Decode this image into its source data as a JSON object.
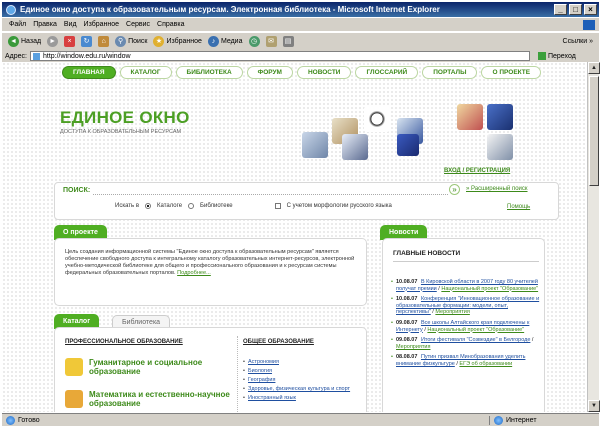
{
  "window": {
    "title": "Единое окно доступа к образовательным ресурсам. Электронная библиотека - Microsoft Internet Explorer",
    "buttons": [
      "_",
      "□",
      "×"
    ]
  },
  "menu": [
    "Файл",
    "Правка",
    "Вид",
    "Избранное",
    "Сервис",
    "Справка"
  ],
  "toolbar": {
    "back": "Назад",
    "search": "Поиск",
    "favorites": "Избранное",
    "media": "Медиа",
    "links": "Ссылки »"
  },
  "address": {
    "label": "Адрес:",
    "url": "http://window.edu.ru/window",
    "go": "Переход"
  },
  "status": {
    "left": "Готово",
    "right": "Интернет"
  },
  "site": {
    "nav": [
      "ГЛАВНАЯ",
      "КАТАЛОГ",
      "БИБЛИОТЕКА",
      "ФОРУМ",
      "НОВОСТИ",
      "ГЛОССАРИЙ",
      "ПОРТАЛЫ",
      "О ПРОЕКТЕ"
    ],
    "brand_title": "ЕДИНОЕ ОКНО",
    "brand_subtitle": "ДОСТУПА К ОБРАЗОВАТЕЛЬНЫМ РЕСУРСАМ",
    "login": "ВХОД / РЕГИСТРАЦИЯ",
    "search": {
      "label": "ПОИСК:",
      "go": "»",
      "advanced": "» Расширенный поиск",
      "search_in": "Искать в",
      "opt_catalog": "Каталоге",
      "opt_library": "Библиотеке",
      "morph": "С учетом морфологии русского языка",
      "help": "Помощь"
    },
    "about": {
      "tab": "О проекте",
      "text": "Цель создания информационной системы \"Единое окно доступа к образовательным ресурсам\" является обеспечение свободного доступа к интегральному каталогу образовательных интернет-ресурсов, электронной учебно-методической библиотеке для общего и профессионального образования и к ресурсам системы федеральных образовательных порталов.",
      "more": "Подробнее..."
    },
    "news": {
      "tab": "Новости",
      "heading": "ГЛАВНЫЕ НОВОСТИ",
      "items": [
        {
          "date": "10.08.07",
          "text": "В Кировской области в 2007 году 80 учителей получат премии",
          "tag": "Национальный проект \"Образование\""
        },
        {
          "date": "10.08.07",
          "text": "Конференция \"Инновационное образование и образовательные формации: модели, опыт, перспективы\"",
          "tag": "Мероприятия"
        },
        {
          "date": "09.08.07",
          "text": "Все школы Алтайского края подключены к Интернету",
          "tag": "Национальный проект \"Образование\""
        },
        {
          "date": "09.08.07",
          "text": "Итоги фестиваля \"Созвездие\" в Белгороде",
          "tag": "Мероприятия"
        },
        {
          "date": "08.08.07",
          "text": "Путин призвал Минобразования уделить внимание физкультуре",
          "tag": "ЕГЭ об образовании"
        }
      ]
    },
    "catalog": {
      "tab": "Каталог",
      "tab2": "Библиотека",
      "prof_heading": "ПРОФЕССИОНАЛЬНОЕ ОБРАЗОВАНИЕ",
      "general_heading": "ОБЩЕЕ ОБРАЗОВАНИЕ",
      "prof_items": [
        "Гуманитарное и социальное образование",
        "Математика и естественно-научное образование"
      ],
      "general_items": [
        "Астрономия",
        "Биология",
        "География",
        "Здоровье, физическая культура и спорт",
        "Иностранный язык"
      ]
    }
  },
  "colors": {
    "accent": "#4fae22",
    "accent_dark": "#3d8a1a",
    "link": "#1f4fa0",
    "titlebar": "#0a246a"
  }
}
